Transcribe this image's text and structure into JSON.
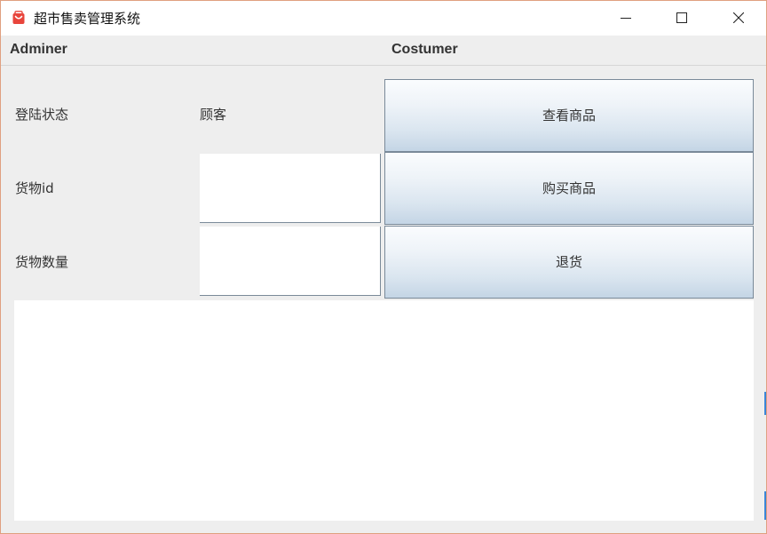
{
  "window": {
    "title": "超市售卖管理系统",
    "icon": "shopping-bag-icon",
    "controls": [
      "minimize-icon",
      "maximize-icon",
      "close-icon"
    ]
  },
  "menu": {
    "items": [
      {
        "label": "Adminer"
      },
      {
        "label": "Costumer"
      }
    ]
  },
  "form": {
    "status_label": "登陆状态",
    "status_value": "顾客",
    "goods_id_label": "货物id",
    "goods_id_value": "",
    "quantity_label": "货物数量",
    "quantity_value": ""
  },
  "actions": {
    "view_label": "查看商品",
    "buy_label": "购买商品",
    "return_label": "退货"
  },
  "output": {
    "text": ""
  },
  "colors": {
    "icon_red": "#e8453c",
    "button_top": "#fafcfe",
    "button_bottom": "#c4d5e5",
    "button_border": "#7a8a99",
    "panel_bg": "#eeeeee"
  }
}
